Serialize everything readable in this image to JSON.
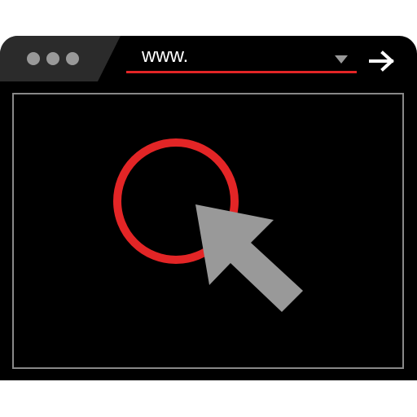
{
  "browser": {
    "address_bar": {
      "value": "www.",
      "underline_color": "#e32526"
    },
    "window_controls": {
      "color": "#999999",
      "count": 3
    },
    "dropdown_icon": "chevron-down-icon",
    "go_icon": "arrow-right-icon"
  },
  "colors": {
    "window": "#000000",
    "tab": "#2b2b2b",
    "accent": "#e32526",
    "cursor": "#999999",
    "frame": "#888888"
  },
  "icons": {
    "target": "circle-target-icon",
    "pointer": "mouse-pointer-icon"
  }
}
